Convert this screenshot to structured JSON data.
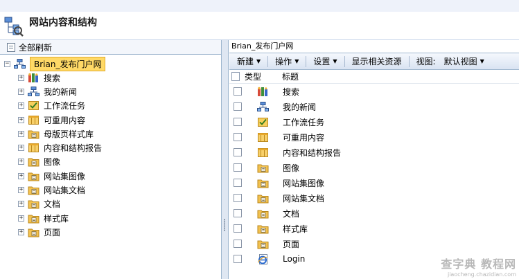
{
  "page": {
    "title": "网站内容和结构"
  },
  "left_toolbar": {
    "refresh_all": "全部刷新"
  },
  "tree": {
    "root": "Brian_发布门户网",
    "items": [
      {
        "label": "搜索",
        "icon": "search-site-icon"
      },
      {
        "label": "我的新闻",
        "icon": "site-icon"
      },
      {
        "label": "工作流任务",
        "icon": "task-list-icon"
      },
      {
        "label": "可重用内容",
        "icon": "list-icon"
      },
      {
        "label": "母版页样式库",
        "icon": "library-icon"
      },
      {
        "label": "内容和结构报告",
        "icon": "list-icon"
      },
      {
        "label": "图像",
        "icon": "library-icon"
      },
      {
        "label": "网站集图像",
        "icon": "library-icon"
      },
      {
        "label": "网站集文档",
        "icon": "library-icon"
      },
      {
        "label": "文档",
        "icon": "library-icon"
      },
      {
        "label": "样式库",
        "icon": "library-icon"
      },
      {
        "label": "页面",
        "icon": "library-icon"
      }
    ]
  },
  "right": {
    "path": "Brian_发布门户网",
    "toolbar": {
      "new": "新建",
      "actions": "操作",
      "settings": "设置",
      "show_related": "显示相关资源",
      "view_label": "视图:",
      "view_value": "默认视图"
    },
    "columns": {
      "type": "类型",
      "title": "标题"
    },
    "rows": [
      {
        "title": "搜索",
        "icon": "search-site-icon"
      },
      {
        "title": "我的新闻",
        "icon": "site-icon"
      },
      {
        "title": "工作流任务",
        "icon": "task-list-icon"
      },
      {
        "title": "可重用内容",
        "icon": "list-icon"
      },
      {
        "title": "内容和结构报告",
        "icon": "list-icon"
      },
      {
        "title": "图像",
        "icon": "library-icon"
      },
      {
        "title": "网站集图像",
        "icon": "library-icon"
      },
      {
        "title": "网站集文档",
        "icon": "library-icon"
      },
      {
        "title": "文档",
        "icon": "library-icon"
      },
      {
        "title": "样式库",
        "icon": "library-icon"
      },
      {
        "title": "页面",
        "icon": "library-icon"
      },
      {
        "title": "Login",
        "icon": "ie-page-icon"
      }
    ]
  },
  "watermark": {
    "main": "查字典 教程网",
    "sub": "jiaocheng.chazidian.com"
  },
  "colors": {
    "selected_bg": "#ffd966",
    "border": "#9eb6ce",
    "toolbar_top": "#f5f8fd",
    "toolbar_bottom": "#d9e3f2"
  }
}
